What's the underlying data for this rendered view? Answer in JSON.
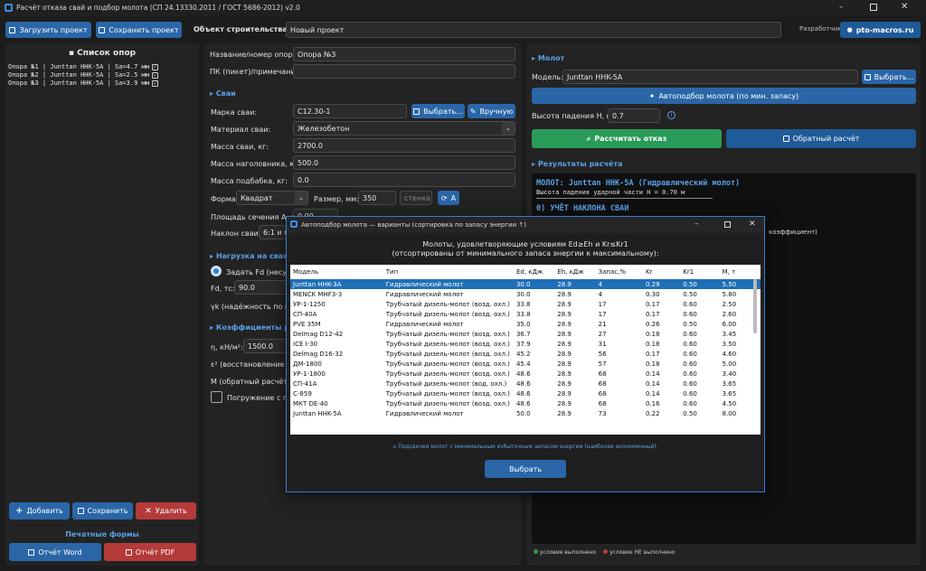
{
  "app": {
    "title": "Расчёт отказа свай и подбор молота (СП 24.13330.2011 / ГОСТ 5686-2012) v2.0"
  },
  "toolbar": {
    "load_label": "Загрузить проект",
    "save_label": "Сохранить проект",
    "object_label": "Объект строительства:",
    "object_value": "Новый проект",
    "developer_label": "Разработчик:",
    "developer_site": "pto-macros.ru"
  },
  "left": {
    "title": "Список опор",
    "items": [
      "Опора №1 | Junttan HHK-5A | Sa=4.7 мм",
      "Опора №2 | Junttan HHK-5A | Sa=2.5 мм",
      "Опора №3 | Junttan HHK-5A | Sa=3.9 мм"
    ],
    "add_label": "Добавить",
    "save_label": "Сохранить",
    "delete_label": "Удалить",
    "print_title": "Печатные формы",
    "word_label": "Отчёт Word",
    "pdf_label": "Отчёт PDF"
  },
  "mid": {
    "name_label": "Название/номер опоры:",
    "name_value": "Опора №3",
    "pk_label": "ПК (пикет)/примечание:",
    "pk_value": "",
    "pile_section": "Сваи",
    "grade_label": "Марка сваи:",
    "grade_value": "С12.30-1",
    "choose_label": "Выбрать...",
    "manual_label": "Вручную",
    "material_label": "Материал сваи:",
    "material_value": "Железобетон",
    "mass_label": "Масса сваи, кг:",
    "mass_value": "2700.0",
    "head_label": "Масса наголовника, кг:",
    "head_value": "500.0",
    "sub_label": "Масса подбабка, кг:",
    "sub_value": "0.0",
    "shape_label": "Форма:",
    "shape_value": "Квадрат",
    "size_label": "Размер, мм:",
    "size_value": "350",
    "wall_placeholder": "стенка",
    "a_label": "A",
    "area_label": "Площадь сечения А, м²:",
    "area_value": "0.09",
    "incline_label": "Наклон сваи:",
    "incline_value": "6:1 и м",
    "load_section": "Нагрузка на сваю",
    "fd_radio_label": "Задать Fd (несущ",
    "fd_label": "Fd, тс:",
    "fd_value": "90.0",
    "yk_label": "γk (надёжность по нагр",
    "coef_section": "Коэффициенты ра",
    "eta_label": "η, кН/м²:",
    "eta_value": "1500.0",
    "eps_label": "ε² (восстановление уд",
    "m_label": "M (обратный расчёт):",
    "immersion_label": "Погружение с по"
  },
  "right": {
    "hammer_section": "Молот",
    "model_label": "Модель:",
    "model_value": "Junttan HHK-5A",
    "choose_label": "Выбрать...",
    "auto_label": "Автоподбор молота (по мин. запасу)",
    "height_label": "Высота падения H, м:",
    "height_value": "0.7",
    "calc_label": "Рассчитать отказ",
    "back_label": "Обратный расчёт",
    "results_section": "Результаты расчёта",
    "result_line1": "МОЛОТ: Junttan HHK-5A  (Гидравлический молот)",
    "result_line2": "Высота падения ударной части  H = 0.70 м",
    "result_line3": "0) УЧЁТ НАКЛОНА СВАИ",
    "result_tail": "коэффициент)",
    "legend_ok": "условие выполнено",
    "legend_fail": "условие НЕ выполнено"
  },
  "dialog": {
    "title": "Автоподбор молота — варианты (сортировка по запасу энергии ↑)",
    "caption1": "Молоты, удовлетворяющие условиям Ed≥Eh и Kr≤Kr1",
    "caption2": "(отсортированы от минимального запаса энергии к максимальному):",
    "columns": [
      "Модель",
      "Тип",
      "Ed, кДж",
      "Eh, кДж",
      "Запас,%",
      "Kr",
      "Kr1",
      "M, т"
    ],
    "rows": [
      [
        "Junttan HHK-3A",
        "Гидравлический молот",
        "30.0",
        "28.9",
        "4",
        "0.29",
        "0.50",
        "5.50"
      ],
      [
        "MENCK MHF3-3",
        "Гидравлический молот",
        "30.0",
        "28.9",
        "4",
        "0.30",
        "0.50",
        "5.80"
      ],
      [
        "УР-1-1250",
        "Трубчатый дизель-молот (возд. охл.)",
        "33.8",
        "28.9",
        "17",
        "0.17",
        "0.60",
        "2.50"
      ],
      [
        "СП-40А",
        "Трубчатый дизель-молот (возд. охл.)",
        "33.8",
        "28.9",
        "17",
        "0.17",
        "0.60",
        "2.60"
      ],
      [
        "PVE 35M",
        "Гидравлический молот",
        "35.0",
        "28.9",
        "21",
        "0.26",
        "0.50",
        "6.00"
      ],
      [
        "Delmag D12-42",
        "Трубчатый дизель-молот (возд. охл.)",
        "36.7",
        "28.9",
        "27",
        "0.18",
        "0.60",
        "3.45"
      ],
      [
        "ICE I-30",
        "Трубчатый дизель-молот (возд. охл.)",
        "37.9",
        "28.9",
        "31",
        "0.18",
        "0.60",
        "3.50"
      ],
      [
        "Delmag D16-32",
        "Трубчатый дизель-молот (возд. охл.)",
        "45.2",
        "28.9",
        "56",
        "0.17",
        "0.60",
        "4.60"
      ],
      [
        "ДМ-1800",
        "Трубчатый дизель-молот (возд. охл.)",
        "45.4",
        "28.9",
        "57",
        "0.18",
        "0.60",
        "5.00"
      ],
      [
        "УР-1-1800",
        "Трубчатый дизель-молот (возд. охл.)",
        "48.6",
        "28.9",
        "68",
        "0.14",
        "0.60",
        "3.40"
      ],
      [
        "СП-41А",
        "Трубчатый дизель-молот (вод. охл.)",
        "48.6",
        "28.9",
        "68",
        "0.14",
        "0.60",
        "3.65"
      ],
      [
        "С-859",
        "Трубчатый дизель-молот (возд. охл.)",
        "48.6",
        "28.9",
        "68",
        "0.14",
        "0.60",
        "3.65"
      ],
      [
        "МКТ DE-40",
        "Трубчатый дизель-молот (возд. охл.)",
        "48.6",
        "28.9",
        "68",
        "0.16",
        "0.60",
        "4.50"
      ],
      [
        "Junttan HHK-5A",
        "Гидравлический молот",
        "50.0",
        "28.9",
        "73",
        "0.22",
        "0.50",
        "8.00"
      ]
    ],
    "note": "Подсвечен молот с минимальным избыточным запасом энергии (наиболее экономичный).",
    "select_label": "Выбрать"
  },
  "colors": {
    "accent": "#2a66a8",
    "green": "#2a9a58",
    "red": "#b53a3a",
    "selection": "#1f6fb8"
  }
}
